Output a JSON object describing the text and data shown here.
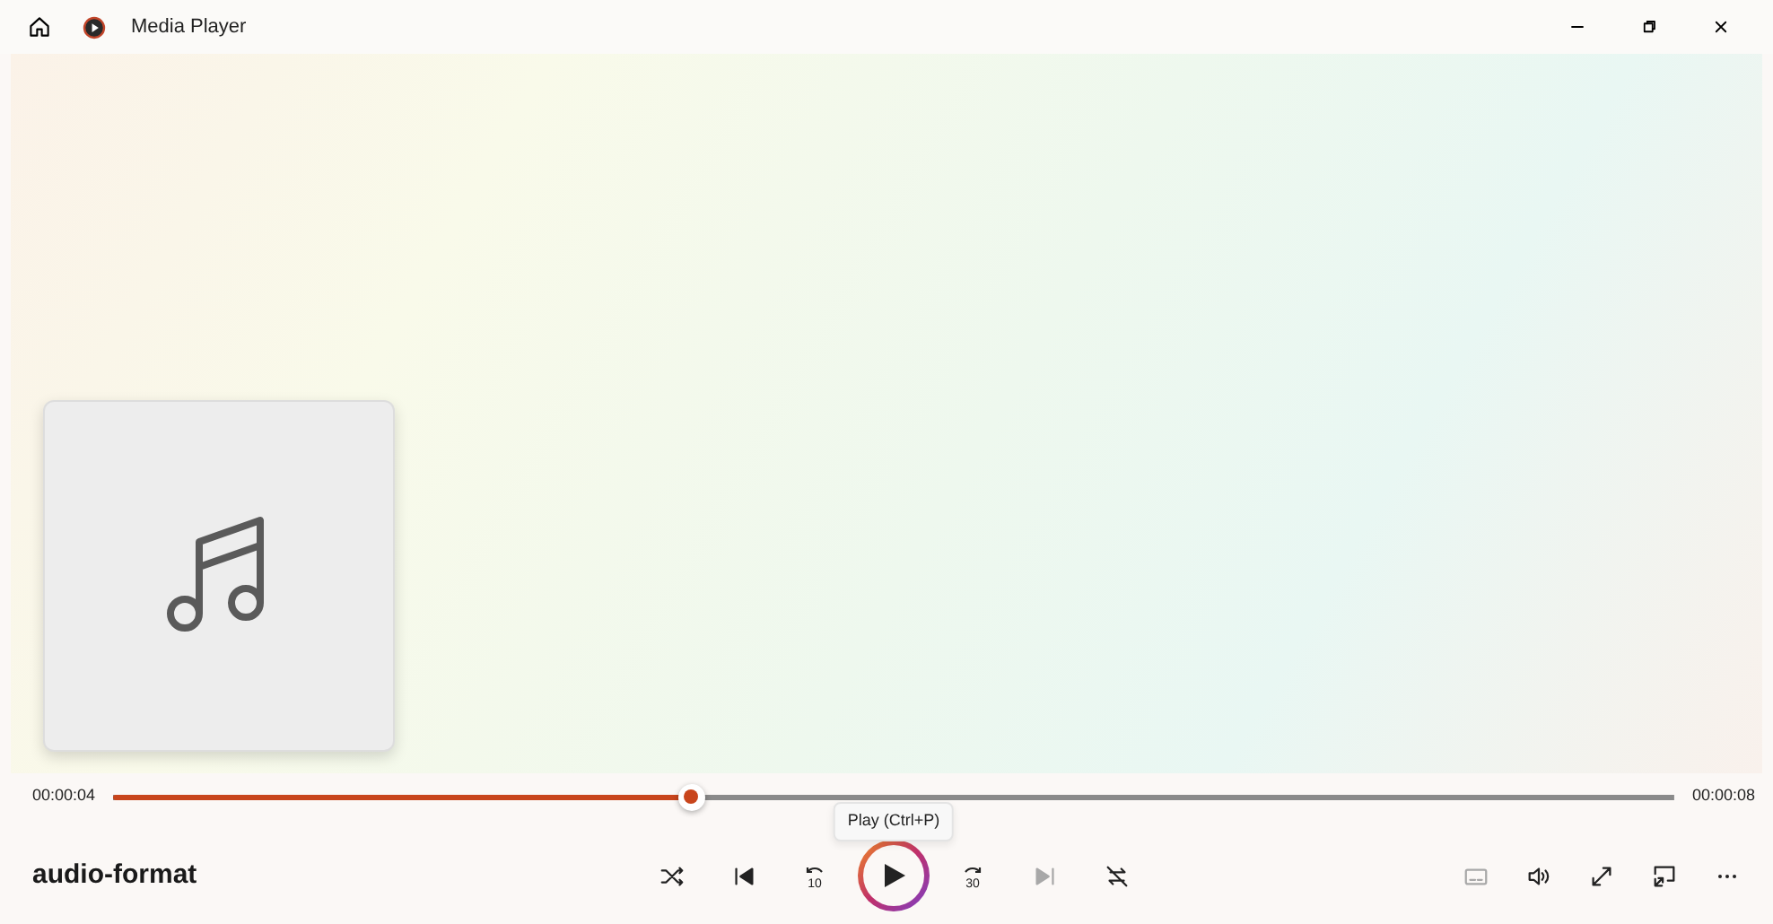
{
  "window": {
    "title": "Media Player"
  },
  "track": {
    "title": "audio-format"
  },
  "progress": {
    "elapsed": "00:00:04",
    "total": "00:00:08",
    "level": 0.37
  },
  "tooltip": {
    "text": "Play (Ctrl+P)"
  },
  "controls": [
    {
      "kind": "shuffle",
      "disabled": false
    },
    {
      "kind": "previous",
      "disabled": false
    },
    {
      "kind": "back",
      "label": "10",
      "disabled": false
    },
    {
      "kind": "play",
      "disabled": false
    },
    {
      "kind": "forward",
      "label": "30",
      "disabled": false
    },
    {
      "kind": "next",
      "disabled": true
    },
    {
      "kind": "repeat",
      "disabled": false
    }
  ],
  "right_controls": [
    {
      "kind": "captions",
      "disabled": true
    },
    {
      "kind": "volume",
      "disabled": false
    },
    {
      "kind": "fullscreen",
      "disabled": false
    },
    {
      "kind": "miniplayer",
      "disabled": false
    },
    {
      "kind": "more",
      "disabled": false
    }
  ]
}
